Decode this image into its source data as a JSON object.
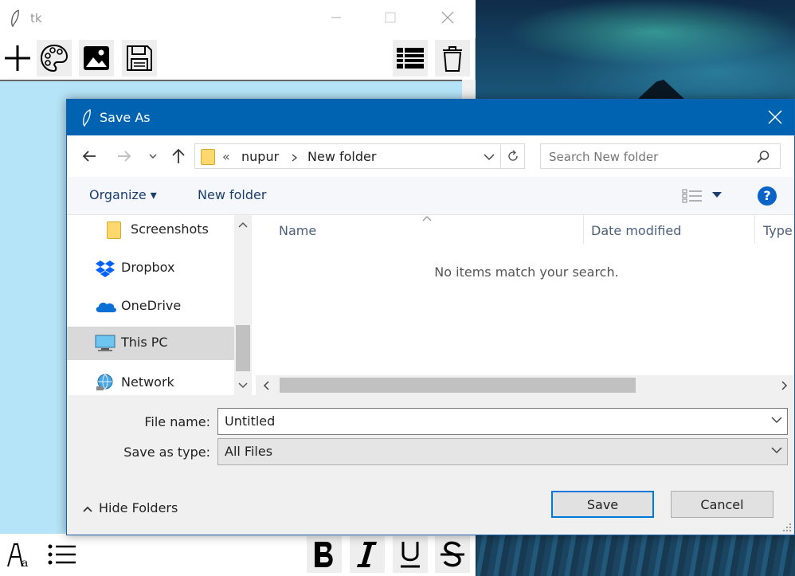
{
  "tk_window": {
    "title": "tk"
  },
  "dialog": {
    "title": "Save As",
    "address": {
      "overflow": "«",
      "crumbs": [
        "nupur",
        "New folder"
      ]
    },
    "search": {
      "placeholder": "Search New folder"
    },
    "commands": {
      "organize": "Organize ▾",
      "new_folder": "New folder",
      "help": "?"
    },
    "nav_items": [
      {
        "label": "Screenshots",
        "icon": "folder-icon"
      },
      {
        "label": "Dropbox",
        "icon": "dropbox-icon"
      },
      {
        "label": "OneDrive",
        "icon": "onedrive-icon"
      },
      {
        "label": "This PC",
        "icon": "computer-icon"
      },
      {
        "label": "Network",
        "icon": "network-icon"
      }
    ],
    "columns": [
      "Name",
      "Date modified",
      "Type"
    ],
    "empty_message": "No items match your search.",
    "file_name": {
      "label": "File name:",
      "value": "Untitled"
    },
    "save_as_type": {
      "label": "Save as type:",
      "value": "All Files"
    },
    "buttons": {
      "save": "Save",
      "cancel": "Cancel",
      "hide_folders": "Hide Folders"
    }
  },
  "colors": {
    "dialog_titlebar": "#0063b1",
    "canvas": "#b5e3f7",
    "accent": "#0078d7"
  }
}
